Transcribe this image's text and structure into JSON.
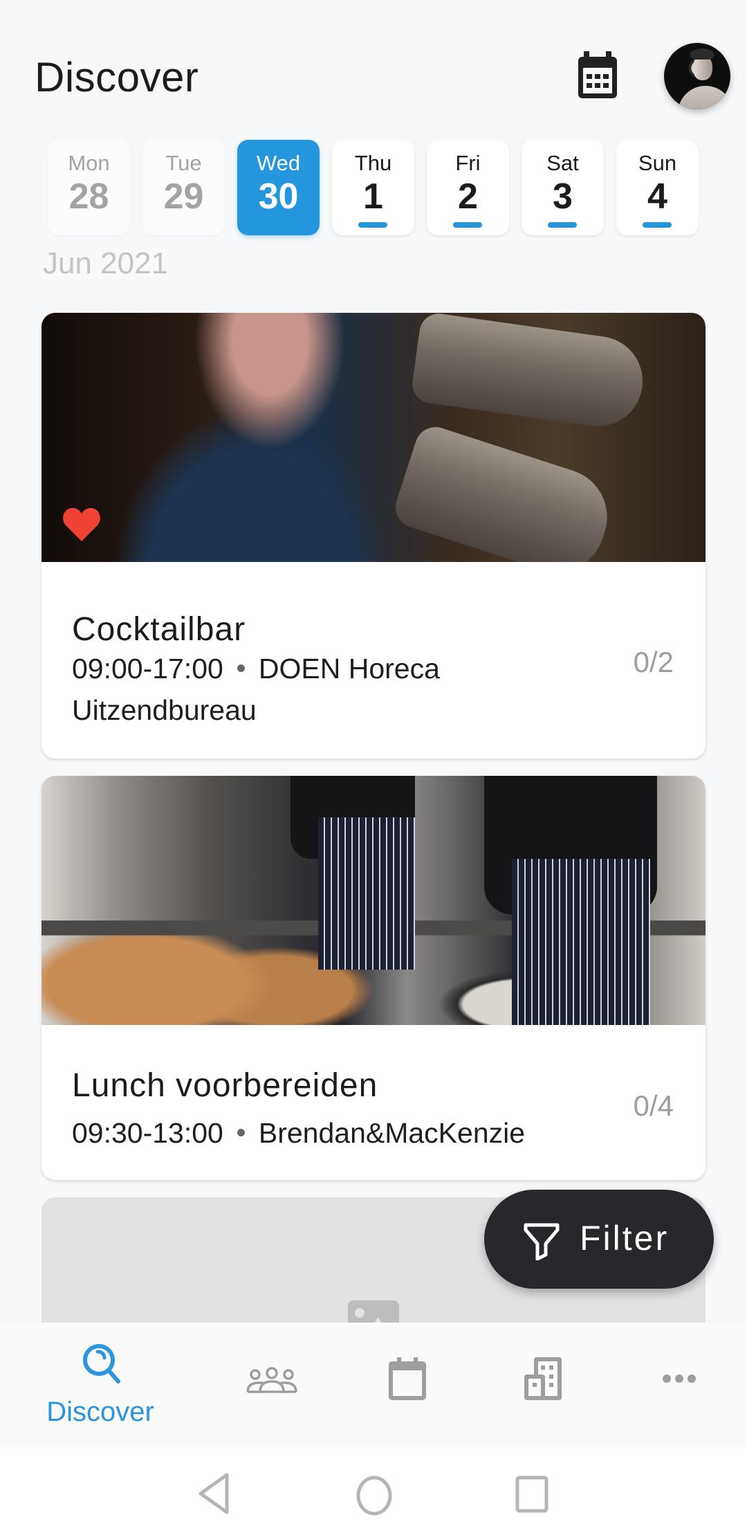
{
  "header": {
    "title": "Discover",
    "calendar_icon": "calendar-icon",
    "avatar_alt": "profile avatar"
  },
  "date_strip": {
    "month_label": "Jun 2021",
    "days": [
      {
        "name": "Mon",
        "number": "28",
        "state": "past",
        "has_shifts": false
      },
      {
        "name": "Tue",
        "number": "29",
        "state": "past",
        "has_shifts": false
      },
      {
        "name": "Wed",
        "number": "30",
        "state": "selected",
        "has_shifts": false
      },
      {
        "name": "Thu",
        "number": "1",
        "state": "future",
        "has_shifts": true
      },
      {
        "name": "Fri",
        "number": "2",
        "state": "future",
        "has_shifts": true
      },
      {
        "name": "Sat",
        "number": "3",
        "state": "future",
        "has_shifts": true
      },
      {
        "name": "Sun",
        "number": "4",
        "state": "future",
        "has_shifts": true
      }
    ],
    "indicator_color": "#2496de"
  },
  "shifts": [
    {
      "title": "Cocktailbar",
      "time": "09:00-17:00",
      "company_line1": "DOEN Horeca",
      "company_line2": "Uitzendbureau",
      "filled": "0/2",
      "favorite": true,
      "image": "bartender-shaking-cocktail"
    },
    {
      "title": "Lunch voorbereiden",
      "time": "09:30-13:00",
      "company_line1": "Brendan&MacKenzie",
      "filled": "0/4",
      "favorite": false,
      "image": "chefs-preparing-food"
    },
    {
      "image": "image-placeholder-icon"
    }
  ],
  "filter_button": {
    "label": "Filter",
    "icon": "funnel-icon"
  },
  "bottom_nav": {
    "items": [
      {
        "id": "discover",
        "label": "Discover",
        "icon": "search-icon",
        "active": true
      },
      {
        "id": "teams",
        "label": "",
        "icon": "people-group-icon",
        "active": false
      },
      {
        "id": "schedule",
        "label": "",
        "icon": "calendar-icon",
        "active": false
      },
      {
        "id": "companies",
        "label": "",
        "icon": "building-icon",
        "active": false
      },
      {
        "id": "more",
        "label": "",
        "icon": "more-dots-icon",
        "active": false
      }
    ],
    "active_color": "#2a95dd",
    "inactive_color": "#9e9e9e"
  },
  "system_nav": {
    "back": "back-icon",
    "home": "home-icon",
    "recents": "recents-icon"
  },
  "colors": {
    "accent": "#2496de",
    "heart": "#f04336",
    "fab": "#27282b",
    "background": "#f6f8fa"
  }
}
